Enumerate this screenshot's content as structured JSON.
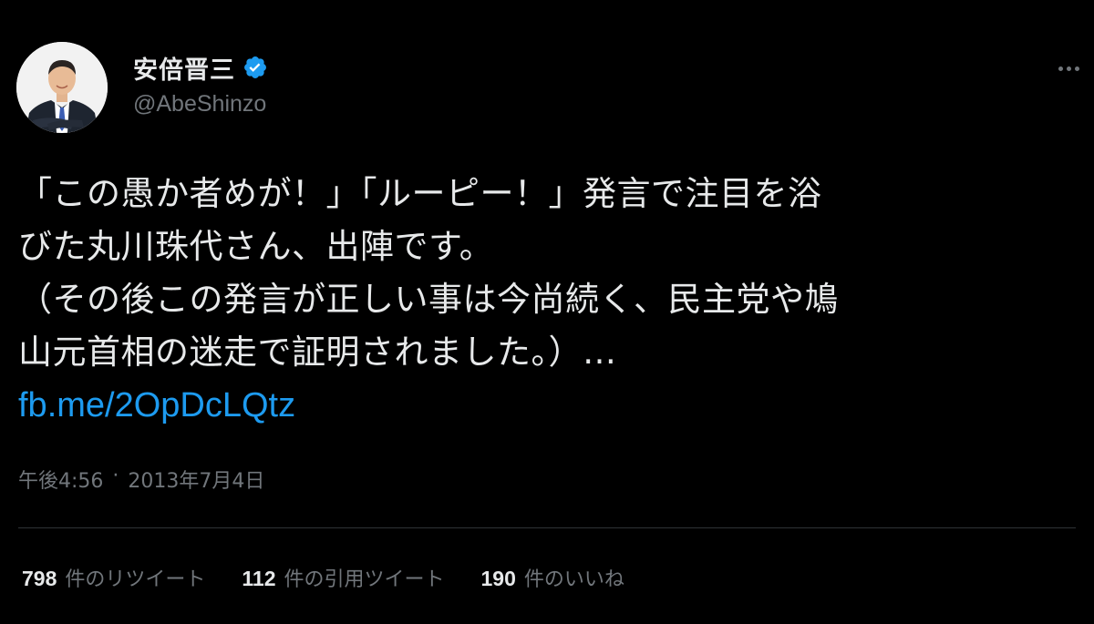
{
  "author": {
    "display_name": "安倍晋三",
    "handle": "@AbeShinzo",
    "verified": true,
    "verified_color": "#1d9bf0"
  },
  "tweet": {
    "lines": [
      "「この愚か者めが！」「ルーピー！」発言で注目を浴",
      "びた丸川珠代さん、出陣です。",
      "（その後この発言が正しい事は今尚続く、民主党や鳩",
      "山元首相の迷走で証明されました。）…"
    ],
    "link": "fb.me/2OpDcLQtz",
    "link_color": "#1d9bf0"
  },
  "meta": {
    "time": "午後4:56",
    "separator": "·",
    "date": "2013年7月4日"
  },
  "stats": {
    "retweets_count": "798",
    "retweets_label": "件のリツイート",
    "quotes_count": "112",
    "quotes_label": "件の引用ツイート",
    "likes_count": "190",
    "likes_label": "件のいいね"
  }
}
